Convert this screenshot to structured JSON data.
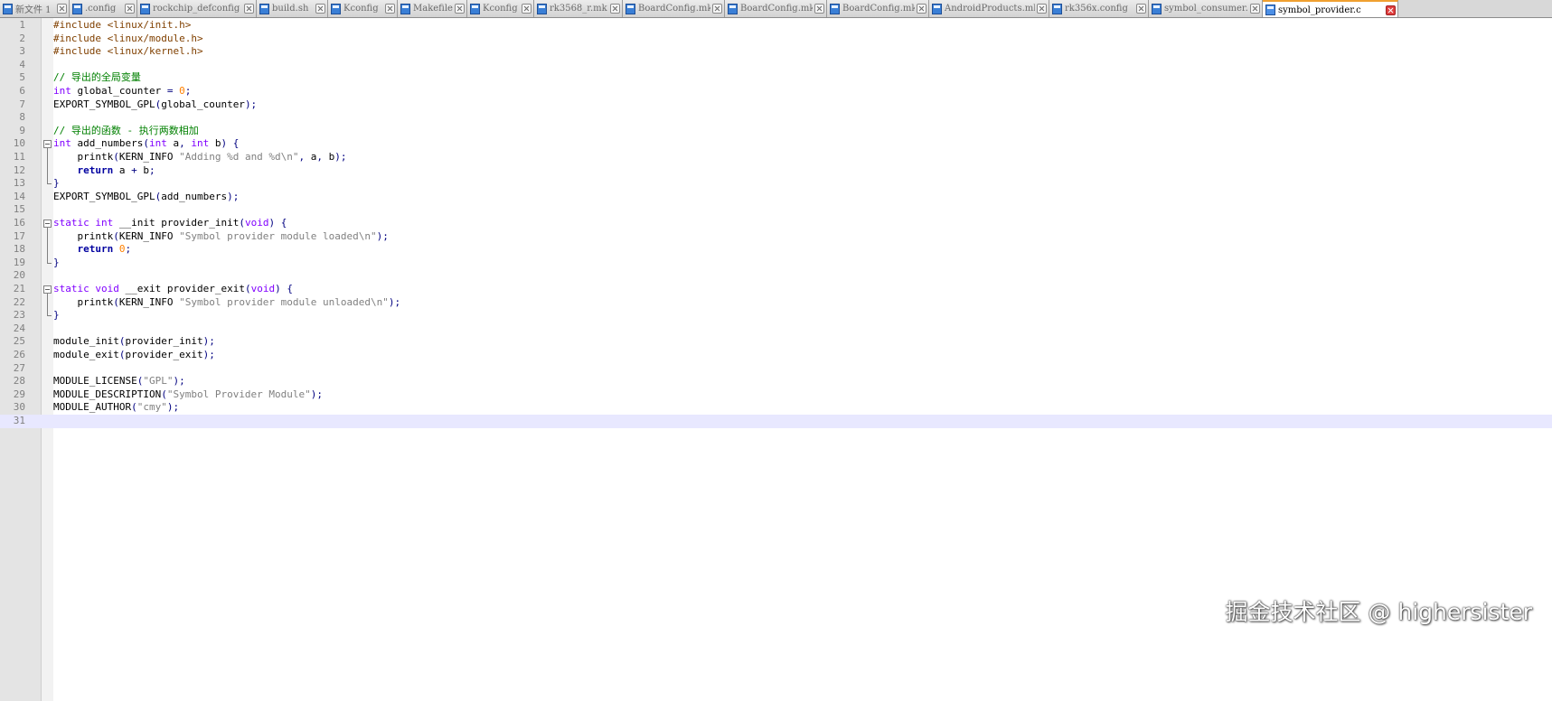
{
  "tabs": [
    {
      "label": "新文件 1",
      "active": false
    },
    {
      "label": ".config",
      "active": false
    },
    {
      "label": "rockchip_defconfig",
      "active": false
    },
    {
      "label": "build.sh",
      "active": false
    },
    {
      "label": "Kconfig",
      "active": false
    },
    {
      "label": "Makefile",
      "active": false
    },
    {
      "label": "Kconfig",
      "active": false
    },
    {
      "label": "rk3568_r.mk",
      "active": false
    },
    {
      "label": "BoardConfig.mk",
      "active": false
    },
    {
      "label": "BoardConfig.mk",
      "active": false
    },
    {
      "label": "BoardConfig.mk",
      "active": false
    },
    {
      "label": "AndroidProducts.mk",
      "active": false
    },
    {
      "label": "rk356x.config",
      "active": false
    },
    {
      "label": "symbol_consumer.c",
      "active": false
    },
    {
      "label": "symbol_provider.c",
      "active": true
    }
  ],
  "editor": {
    "current_line": 31,
    "lines": [
      [
        [
          "pp",
          "#include <linux/init.h>"
        ]
      ],
      [
        [
          "pp",
          "#include <linux/module.h>"
        ]
      ],
      [
        [
          "pp",
          "#include <linux/kernel.h>"
        ]
      ],
      [],
      [
        [
          "cm",
          "// 导出的全局变量"
        ]
      ],
      [
        [
          "kw",
          "int"
        ],
        [
          "",
          " global_counter "
        ],
        [
          "op",
          "="
        ],
        [
          "",
          " "
        ],
        [
          "nm",
          "0"
        ],
        [
          "op",
          ";"
        ]
      ],
      [
        [
          "",
          "EXPORT_SYMBOL_GPL"
        ],
        [
          "op",
          "("
        ],
        [
          "",
          "global_counter"
        ],
        [
          "op",
          ");"
        ]
      ],
      [],
      [
        [
          "cm",
          "// 导出的函数 - 执行两数相加"
        ]
      ],
      [
        [
          "kw",
          "int"
        ],
        [
          "",
          " add_numbers"
        ],
        [
          "op",
          "("
        ],
        [
          "kw",
          "int"
        ],
        [
          "",
          " a"
        ],
        [
          "op",
          ","
        ],
        [
          "",
          " "
        ],
        [
          "kw",
          "int"
        ],
        [
          "",
          " b"
        ],
        [
          "op",
          ")"
        ],
        [
          "",
          " "
        ],
        [
          "op",
          "{"
        ]
      ],
      [
        [
          "",
          "    printk"
        ],
        [
          "op",
          "("
        ],
        [
          "",
          "KERN_INFO "
        ],
        [
          "st",
          "\"Adding %d and %d\\n\""
        ],
        [
          "op",
          ","
        ],
        [
          "",
          " a"
        ],
        [
          "op",
          ","
        ],
        [
          "",
          " b"
        ],
        [
          "op",
          ");"
        ]
      ],
      [
        [
          "",
          "    "
        ],
        [
          "kwb",
          "return"
        ],
        [
          "",
          " a "
        ],
        [
          "op",
          "+"
        ],
        [
          "",
          " b"
        ],
        [
          "op",
          ";"
        ]
      ],
      [
        [
          "op",
          "}"
        ]
      ],
      [
        [
          "",
          "EXPORT_SYMBOL_GPL"
        ],
        [
          "op",
          "("
        ],
        [
          "",
          "add_numbers"
        ],
        [
          "op",
          ");"
        ]
      ],
      [],
      [
        [
          "kw",
          "static"
        ],
        [
          "",
          " "
        ],
        [
          "kw",
          "int"
        ],
        [
          "",
          " __init provider_init"
        ],
        [
          "op",
          "("
        ],
        [
          "kw",
          "void"
        ],
        [
          "op",
          ")"
        ],
        [
          "",
          " "
        ],
        [
          "op",
          "{"
        ]
      ],
      [
        [
          "",
          "    printk"
        ],
        [
          "op",
          "("
        ],
        [
          "",
          "KERN_INFO "
        ],
        [
          "st",
          "\"Symbol provider module loaded\\n\""
        ],
        [
          "op",
          ");"
        ]
      ],
      [
        [
          "",
          "    "
        ],
        [
          "kwb",
          "return"
        ],
        [
          "",
          " "
        ],
        [
          "nm",
          "0"
        ],
        [
          "op",
          ";"
        ]
      ],
      [
        [
          "op",
          "}"
        ]
      ],
      [],
      [
        [
          "kw",
          "static"
        ],
        [
          "",
          " "
        ],
        [
          "kw",
          "void"
        ],
        [
          "",
          " __exit provider_exit"
        ],
        [
          "op",
          "("
        ],
        [
          "kw",
          "void"
        ],
        [
          "op",
          ")"
        ],
        [
          "",
          " "
        ],
        [
          "op",
          "{"
        ]
      ],
      [
        [
          "",
          "    printk"
        ],
        [
          "op",
          "("
        ],
        [
          "",
          "KERN_INFO "
        ],
        [
          "st",
          "\"Symbol provider module unloaded\\n\""
        ],
        [
          "op",
          ");"
        ]
      ],
      [
        [
          "op",
          "}"
        ]
      ],
      [],
      [
        [
          "",
          "module_init"
        ],
        [
          "op",
          "("
        ],
        [
          "",
          "provider_init"
        ],
        [
          "op",
          ");"
        ]
      ],
      [
        [
          "",
          "module_exit"
        ],
        [
          "op",
          "("
        ],
        [
          "",
          "provider_exit"
        ],
        [
          "op",
          ");"
        ]
      ],
      [],
      [
        [
          "",
          "MODULE_LICENSE"
        ],
        [
          "op",
          "("
        ],
        [
          "st",
          "\"GPL\""
        ],
        [
          "op",
          ");"
        ]
      ],
      [
        [
          "",
          "MODULE_DESCRIPTION"
        ],
        [
          "op",
          "("
        ],
        [
          "st",
          "\"Symbol Provider Module\""
        ],
        [
          "op",
          ");"
        ]
      ],
      [
        [
          "",
          "MODULE_AUTHOR"
        ],
        [
          "op",
          "("
        ],
        [
          "st",
          "\"cmy\""
        ],
        [
          "op",
          ");"
        ]
      ],
      []
    ],
    "fold_blocks": [
      [
        10,
        13
      ],
      [
        16,
        19
      ],
      [
        21,
        23
      ]
    ]
  },
  "watermark": "掘金技术社区 @ highersister",
  "colors": {
    "comment": "#008000",
    "keyword": "#8000ff",
    "string": "#808080",
    "number": "#ff8000",
    "preprocessor": "#804000",
    "current_line": "#e8e8ff"
  }
}
